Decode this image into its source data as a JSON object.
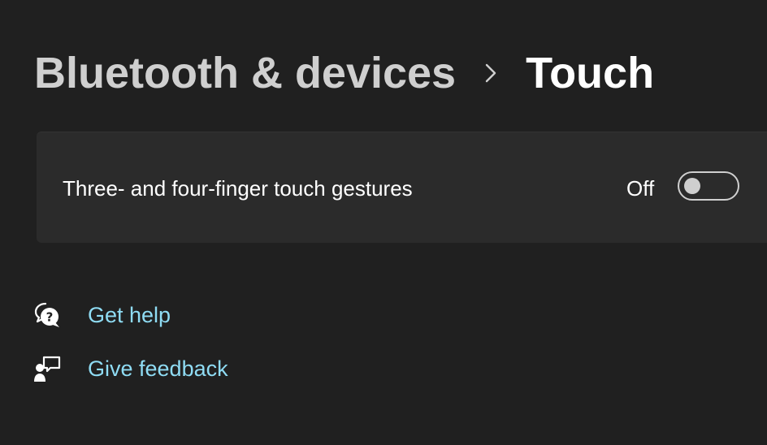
{
  "breadcrumb": {
    "parent": "Bluetooth & devices",
    "separator_icon": "chevron-right-icon",
    "current": "Touch"
  },
  "setting": {
    "label": "Three- and four-finger touch gestures",
    "state_text": "Off",
    "toggle_on": false
  },
  "links": {
    "help": {
      "label": "Get help",
      "icon": "help-chat-icon"
    },
    "feedback": {
      "label": "Give feedback",
      "icon": "feedback-icon"
    }
  },
  "colors": {
    "background": "#202020",
    "card": "#2b2b2b",
    "link": "#8fdcf4"
  }
}
